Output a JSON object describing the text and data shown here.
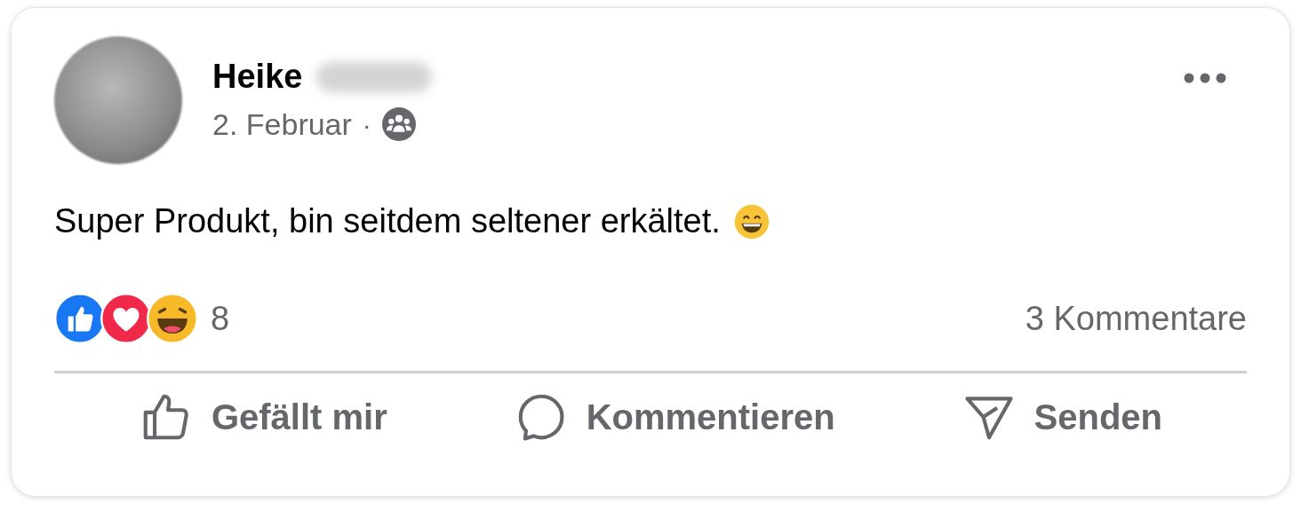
{
  "post": {
    "author": "Heike",
    "date": "2. Februar",
    "separator": "·",
    "text": "Super Produkt, bin seitdem seltener erkältet.",
    "reaction_count": "8",
    "comments": "3 Kommentare",
    "actions": [
      {
        "kind": "like",
        "label": "Gefällt mir"
      },
      {
        "kind": "comment",
        "label": "Kommentieren"
      },
      {
        "kind": "send",
        "label": "Senden"
      }
    ]
  }
}
